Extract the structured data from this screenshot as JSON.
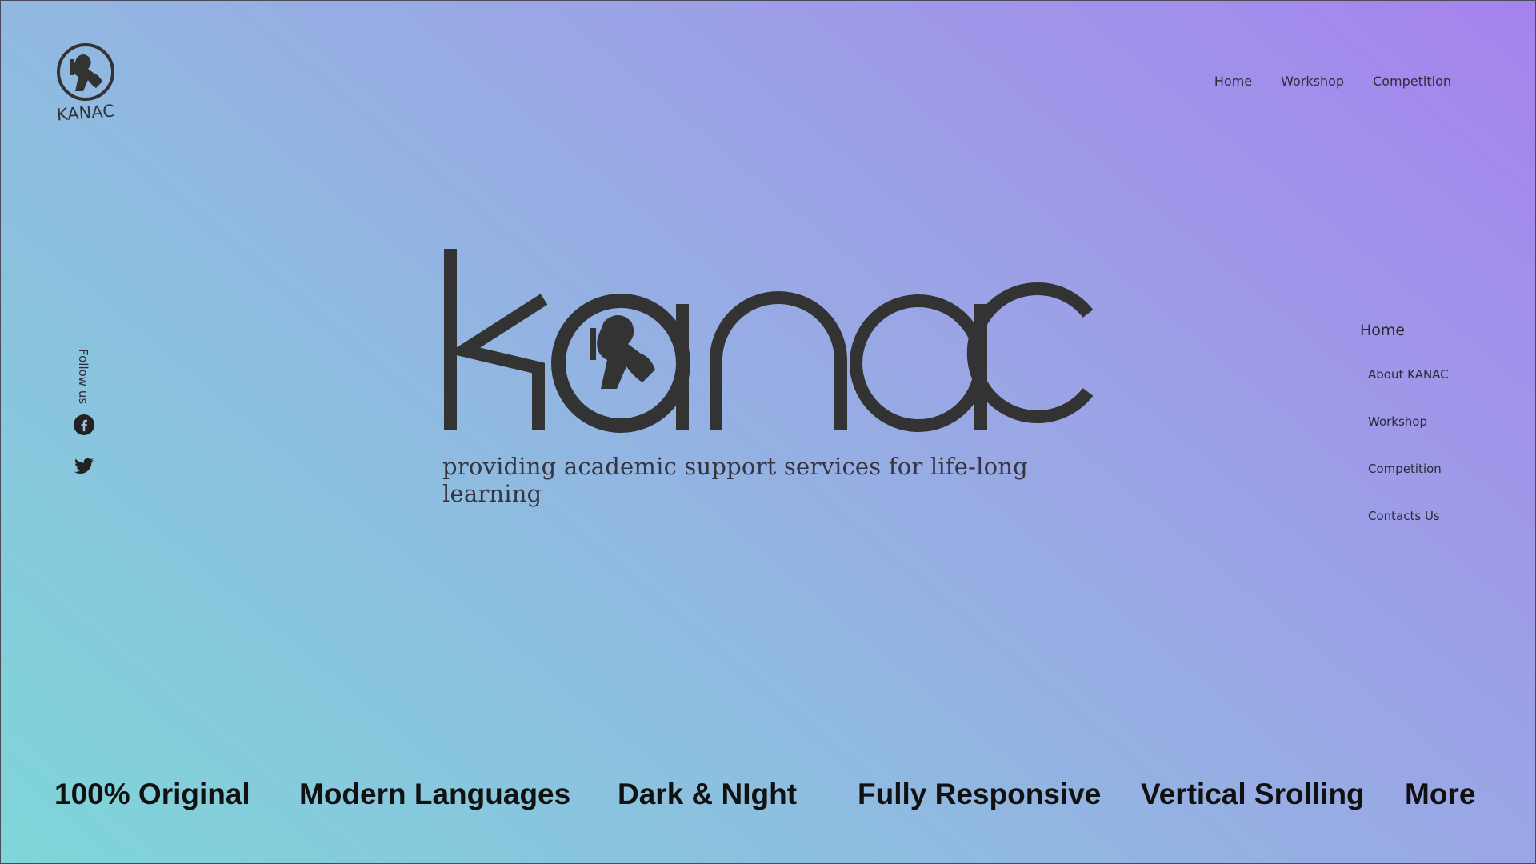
{
  "brand": {
    "logo_text": "KANAC",
    "wordmark": "kanac",
    "tagline": "providing academic support services for life-long learning"
  },
  "top_nav": {
    "items": [
      {
        "label": "Home"
      },
      {
        "label": "Workshop"
      },
      {
        "label": "Competition"
      }
    ]
  },
  "social": {
    "label": "Follow us",
    "icons": [
      "facebook-icon",
      "twitter-icon"
    ]
  },
  "side_nav": {
    "active": "Home",
    "items": [
      {
        "label": "About KANAC"
      },
      {
        "label": "Workshop"
      },
      {
        "label": "Competition"
      },
      {
        "label": "Contacts Us"
      }
    ]
  },
  "features": [
    {
      "label": "100% Original"
    },
    {
      "label": "Modern Languages"
    },
    {
      "label": "Dark & NIght"
    },
    {
      "label": "Fully Responsive"
    },
    {
      "label": "Vertical Srolling"
    },
    {
      "label": "More"
    }
  ],
  "colors": {
    "text_dark": "#333333",
    "gradient_start": "#a582ee",
    "gradient_end": "#7ed6d8"
  }
}
